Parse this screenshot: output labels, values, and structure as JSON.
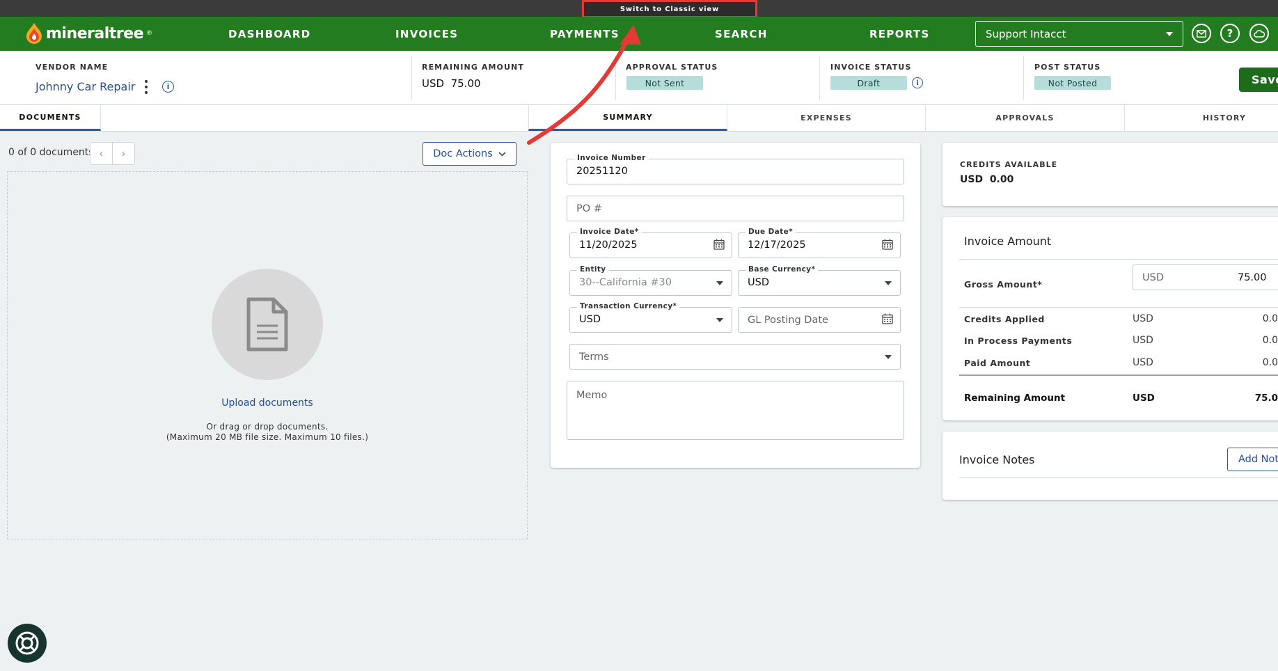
{
  "banner": {
    "classic_view_label": "Switch to Classic view"
  },
  "nav": {
    "logo_text": "mineraltree",
    "logo_mark": "®",
    "items": [
      {
        "label": "DASHBOARD"
      },
      {
        "label": "INVOICES"
      },
      {
        "label": "PAYMENTS"
      },
      {
        "label": "SEARCH"
      },
      {
        "label": "REPORTS"
      }
    ],
    "org_select": "Support Intacct",
    "icons": [
      "mail-icon",
      "help-icon",
      "cloud-icon"
    ]
  },
  "header": {
    "vendor_name_label": "VENDOR NAME",
    "vendor_name": "Johnny Car Repair",
    "remaining_amount_label": "REMAINING AMOUNT",
    "remaining_amount": "USD  75.00",
    "approval_status_label": "APPROVAL STATUS",
    "approval_status": "Not Sent",
    "invoice_status_label": "INVOICE STATUS",
    "invoice_status": "Draft",
    "post_status_label": "POST STATUS",
    "post_status": "Not Posted",
    "save_label": "Save"
  },
  "tabs": {
    "documents": "DOCUMENTS",
    "summary": "SUMMARY",
    "expenses": "EXPENSES",
    "approvals": "APPROVALS",
    "history": "HISTORY"
  },
  "documents": {
    "count_text": "0 of 0 documents",
    "doc_actions": "Doc Actions",
    "upload_link": "Upload documents",
    "drag_line1": "Or drag or drop documents.",
    "drag_line2": "(Maximum 20 MB file size. Maximum 10 files.)"
  },
  "form": {
    "invoice_number_label": "Invoice Number",
    "invoice_number": "20251120",
    "po_placeholder": "PO #",
    "invoice_date_label": "Invoice Date*",
    "invoice_date": "11/20/2025",
    "due_date_label": "Due Date*",
    "due_date": "12/17/2025",
    "entity_label": "Entity",
    "entity": "30--California #30",
    "base_currency_label": "Base Currency*",
    "base_currency": "USD",
    "transaction_currency_label": "Transaction Currency*",
    "transaction_currency": "USD",
    "gl_posting_date_placeholder": "GL Posting Date",
    "terms_placeholder": "Terms",
    "memo_placeholder": "Memo"
  },
  "credits": {
    "label": "CREDITS AVAILABLE",
    "value": "USD  0.00"
  },
  "invoice_amount": {
    "title": "Invoice Amount",
    "gross_label": "Gross Amount*",
    "gross_currency": "USD",
    "gross_value": "75.00",
    "rows": [
      {
        "label": "Credits Applied",
        "currency": "USD",
        "value": "0.0"
      },
      {
        "label": "In Process Payments",
        "currency": "USD",
        "value": "0.0"
      },
      {
        "label": "Paid Amount",
        "currency": "USD",
        "value": "0.0"
      }
    ],
    "remaining_label": "Remaining Amount",
    "remaining_currency": "USD",
    "remaining_value": "75.0"
  },
  "notes": {
    "title": "Invoice Notes",
    "add_button": "Add Not"
  },
  "colors": {
    "nav_green": "#237d20",
    "accent_blue": "#2a59a8",
    "status_pill": "#b6ddd9",
    "annotation_red": "#e53935"
  }
}
